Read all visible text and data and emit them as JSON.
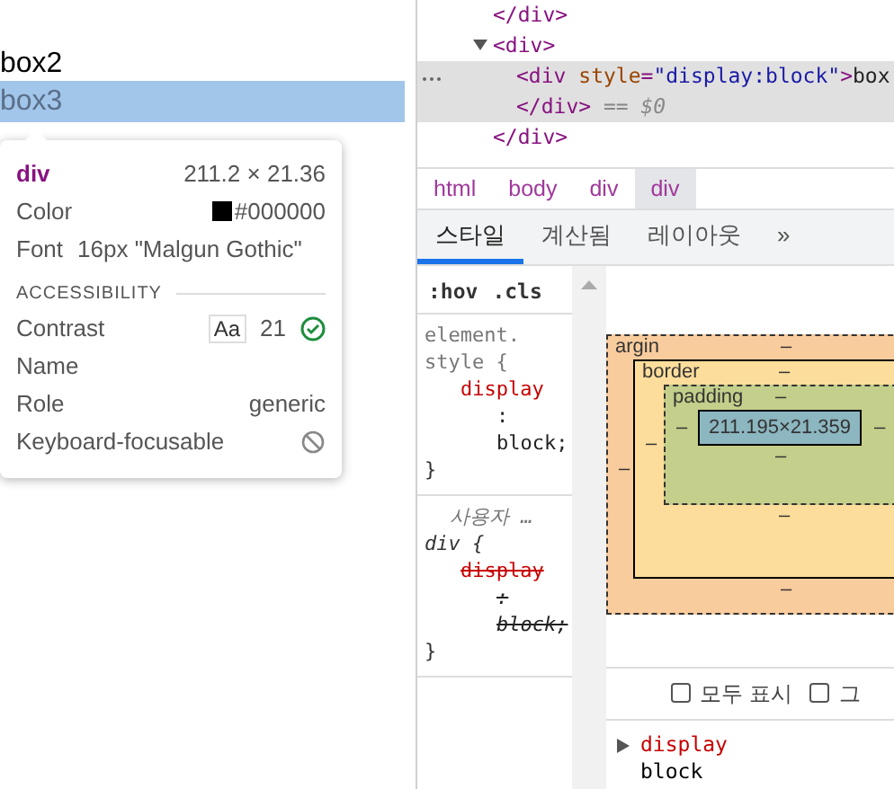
{
  "page": {
    "lines": [
      {
        "text": "box2",
        "selected": false
      },
      {
        "text": "box3",
        "selected": true
      }
    ]
  },
  "tooltip": {
    "tag": "div",
    "size": "211.2 × 21.36",
    "color_label": "Color",
    "color_value": "#000000",
    "font_label": "Font",
    "font_value": "16px \"Malgun Gothic\"",
    "section": "ACCESSIBILITY",
    "rows": [
      {
        "kind": "contrast",
        "label": "Contrast",
        "badge": "Aa",
        "value": "21",
        "passed": true
      },
      {
        "kind": "text",
        "label": "Name"
      },
      {
        "kind": "text",
        "label": "Role",
        "value": "generic"
      },
      {
        "kind": "focusable",
        "label": "Keyboard-focusable",
        "focusable": false
      }
    ]
  },
  "dom_tree": [
    {
      "kind": "close",
      "text": "</div>"
    },
    {
      "kind": "element",
      "expanded": true,
      "open": "<div>",
      "close": "</div>",
      "children": [
        {
          "kind": "element",
          "selected": true,
          "tag": "<div",
          "attr_name": "style",
          "attr_eq": "=",
          "attr_value": "\"display:block\"",
          "tag_end": ">",
          "text": "box",
          "close": "</div>",
          "marker": "== $0"
        }
      ]
    }
  ],
  "breadcrumbs": [
    {
      "label": "html",
      "selected": false
    },
    {
      "label": "body",
      "selected": false
    },
    {
      "label": "div",
      "selected": false
    },
    {
      "label": "div",
      "selected": true
    }
  ],
  "tabs": [
    {
      "label": "스타일",
      "selected": true
    },
    {
      "label": "계산됨",
      "selected": false
    },
    {
      "label": "레이아웃",
      "selected": false
    }
  ],
  "more_tabs": "»",
  "styles": {
    "filters": [
      ":hov",
      ".cls"
    ],
    "rules": [
      {
        "selector_lines": [
          "element.",
          "style {"
        ],
        "properties": [
          {
            "name": "display",
            "colon": ":",
            "value": "block;",
            "overridden": false
          }
        ],
        "close": "}"
      },
      {
        "origin": "사용자 …",
        "selector_lines": [
          "div {"
        ],
        "properties": [
          {
            "name": "display",
            "colon": ":",
            "value": "block;",
            "overridden": true
          }
        ],
        "close": "}"
      }
    ]
  },
  "box_model": {
    "margin": {
      "label": "argin",
      "top": "–",
      "bottom": "–",
      "left": "–"
    },
    "border": {
      "label": "border",
      "top": "–",
      "bottom": "–",
      "left": "–"
    },
    "padding": {
      "label": "padding",
      "top": "–",
      "bottom": "–",
      "left": "–",
      "right": "–"
    },
    "content": "211.195×21.359"
  },
  "computed_filters": [
    {
      "label": "모두 표시",
      "checked": false
    },
    {
      "label": "그",
      "checked": false
    }
  ],
  "computed": [
    {
      "name": "display",
      "value": "block",
      "expanded": false
    }
  ]
}
